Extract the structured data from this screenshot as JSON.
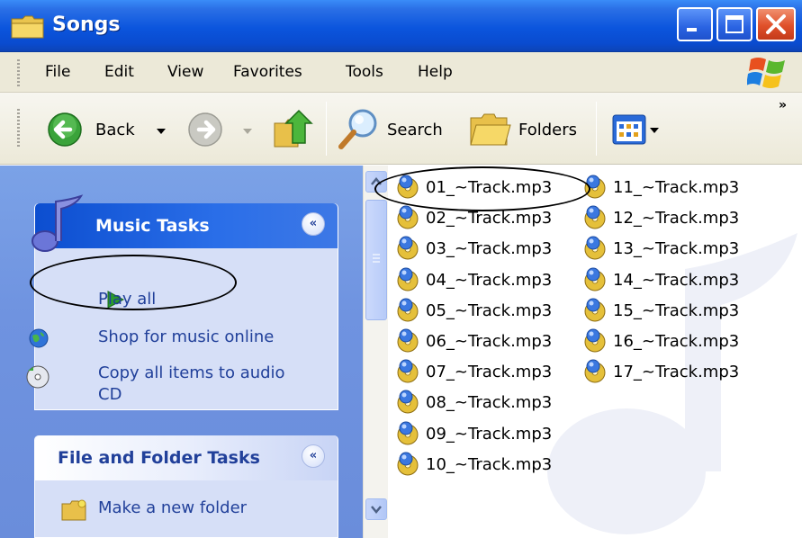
{
  "window": {
    "title": "Songs",
    "folder_icon": "folder-icon"
  },
  "menu": {
    "items": [
      "File",
      "Edit",
      "View",
      "Favorites",
      "Tools",
      "Help"
    ]
  },
  "toolbar": {
    "back_label": "Back",
    "search_label": "Search",
    "folders_label": "Folders",
    "overflow": "»"
  },
  "music_tasks": {
    "title": "Music Tasks",
    "collapse": "«",
    "links": [
      {
        "label": "Play all",
        "icon": "play-icon"
      },
      {
        "label": "Shop for music online",
        "icon": "globe-icon"
      },
      {
        "label_line1": "Copy all items to audio",
        "label_line2": "CD",
        "icon": "cd-copy-icon"
      }
    ]
  },
  "file_folder_tasks": {
    "title": "File and Folder Tasks",
    "collapse": "«",
    "links": [
      {
        "label": "Make a new folder",
        "icon": "new-folder-icon"
      }
    ]
  },
  "files": [
    "01_~Track.mp3",
    "02_~Track.mp3",
    "03_~Track.mp3",
    "04_~Track.mp3",
    "05_~Track.mp3",
    "06_~Track.mp3",
    "07_~Track.mp3",
    "08_~Track.mp3",
    "09_~Track.mp3",
    "10_~Track.mp3",
    "11_~Track.mp3",
    "12_~Track.mp3",
    "13_~Track.mp3",
    "14_~Track.mp3",
    "15_~Track.mp3",
    "16_~Track.mp3",
    "17_~Track.mp3"
  ],
  "colors": {
    "titlebar": "#0b55dd",
    "taskpane": "#6f93e0",
    "link": "#21409a"
  }
}
